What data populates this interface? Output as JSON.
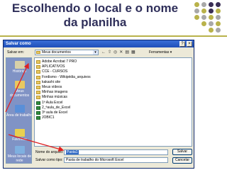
{
  "slide": {
    "title_line1": "Escolhendo o local e o nome",
    "title_line2": "da planilha",
    "dot_colors": {
      "olive": "#b9b24a",
      "gray": "#a8a8a8",
      "purple": "#3a2e55"
    }
  },
  "dialog": {
    "title": "Salvar como",
    "help_button": "?",
    "close_button": "×",
    "save_in_label": "Salvar em:",
    "save_in_value": "Meus documentos",
    "tools_label": "Ferramentas",
    "places": [
      {
        "label": "Histórico",
        "icon": "history-icon"
      },
      {
        "label": "Meus documentos",
        "icon": "my-documents-icon"
      },
      {
        "label": "Área de trabalho",
        "icon": "desktop-icon"
      },
      {
        "label": "Favoritos",
        "icon": "favorites-icon"
      },
      {
        "label": "Meus locais de rede",
        "icon": "network-places-icon"
      }
    ],
    "files": [
      {
        "name": "Adobe Acrobat 7 PRO",
        "type": "folder"
      },
      {
        "name": "APLICATIVOS",
        "type": "folder"
      },
      {
        "name": "CCE - CURSOS",
        "type": "folder"
      },
      {
        "name": "Fordismo - Wikipédia_arquivos",
        "type": "folder"
      },
      {
        "name": "kakashi site",
        "type": "folder"
      },
      {
        "name": "Meus vídeos",
        "type": "folder"
      },
      {
        "name": "Minhas imagens",
        "type": "folder"
      },
      {
        "name": "Minhas músicas",
        "type": "folder"
      },
      {
        "name": "1ª Aula Excel",
        "type": "xls"
      },
      {
        "name": "2_ªaula_de_Excel",
        "type": "xls"
      },
      {
        "name": "3ª aula de Excel",
        "type": "xls"
      },
      {
        "name": "JOBIC1",
        "type": "xls"
      }
    ],
    "filename_label": "Nome do arquivo:",
    "filename_value": "Pasta1",
    "filetype_label": "Salvar como tipo:",
    "filetype_value": "Pasta de trabalho do Microsoft Excel",
    "save_button": "Salvar",
    "cancel_button": "Cancelar"
  }
}
